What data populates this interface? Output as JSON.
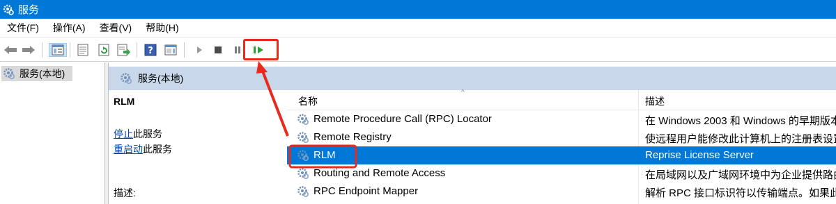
{
  "window": {
    "title": "服务"
  },
  "menu": [
    {
      "label": "文件(F)"
    },
    {
      "label": "操作(A)"
    },
    {
      "label": "查看(V)"
    },
    {
      "label": "帮助(H)"
    }
  ],
  "toolbar": {
    "buttons": [
      "back-icon",
      "forward-icon",
      "show-hide-tree-icon",
      "properties-icon",
      "refresh-icon",
      "export-list-icon",
      "help-icon",
      "action-pane-icon",
      "start-service-icon",
      "stop-service-icon",
      "pause-service-icon",
      "resume-service-icon"
    ]
  },
  "tree": {
    "root_label": "服务(本地)"
  },
  "pane": {
    "header": "服务(本地)"
  },
  "detail": {
    "service_name": "RLM",
    "stop_link": "停止",
    "stop_suffix": "此服务",
    "restart_link": "重启动",
    "restart_suffix": "此服务",
    "description_label": "描述:"
  },
  "list": {
    "columns": {
      "name": "名称",
      "description": "描述",
      "sort_indicator": "^"
    },
    "rows": [
      {
        "name": "Remote Procedure Call (RPC) Locator",
        "description": "在 Windows 2003 和 Windows 的早期版本"
      },
      {
        "name": "Remote Registry",
        "description": "使远程用户能修改此计算机上的注册表设置"
      },
      {
        "name": "RLM",
        "description": "Reprise License Server",
        "selected": true
      },
      {
        "name": "Routing and Remote Access",
        "description": "在局域网以及广域网环境中为企业提供路由"
      },
      {
        "name": "RPC Endpoint Mapper",
        "description": "解析 RPC 接口标识符以传输端点。如果此"
      }
    ]
  },
  "colors": {
    "titlebar": "#0078d7",
    "selection": "#0078d7",
    "highlight_annotation": "#e8291c",
    "pane_header": "#c8d8ea"
  }
}
